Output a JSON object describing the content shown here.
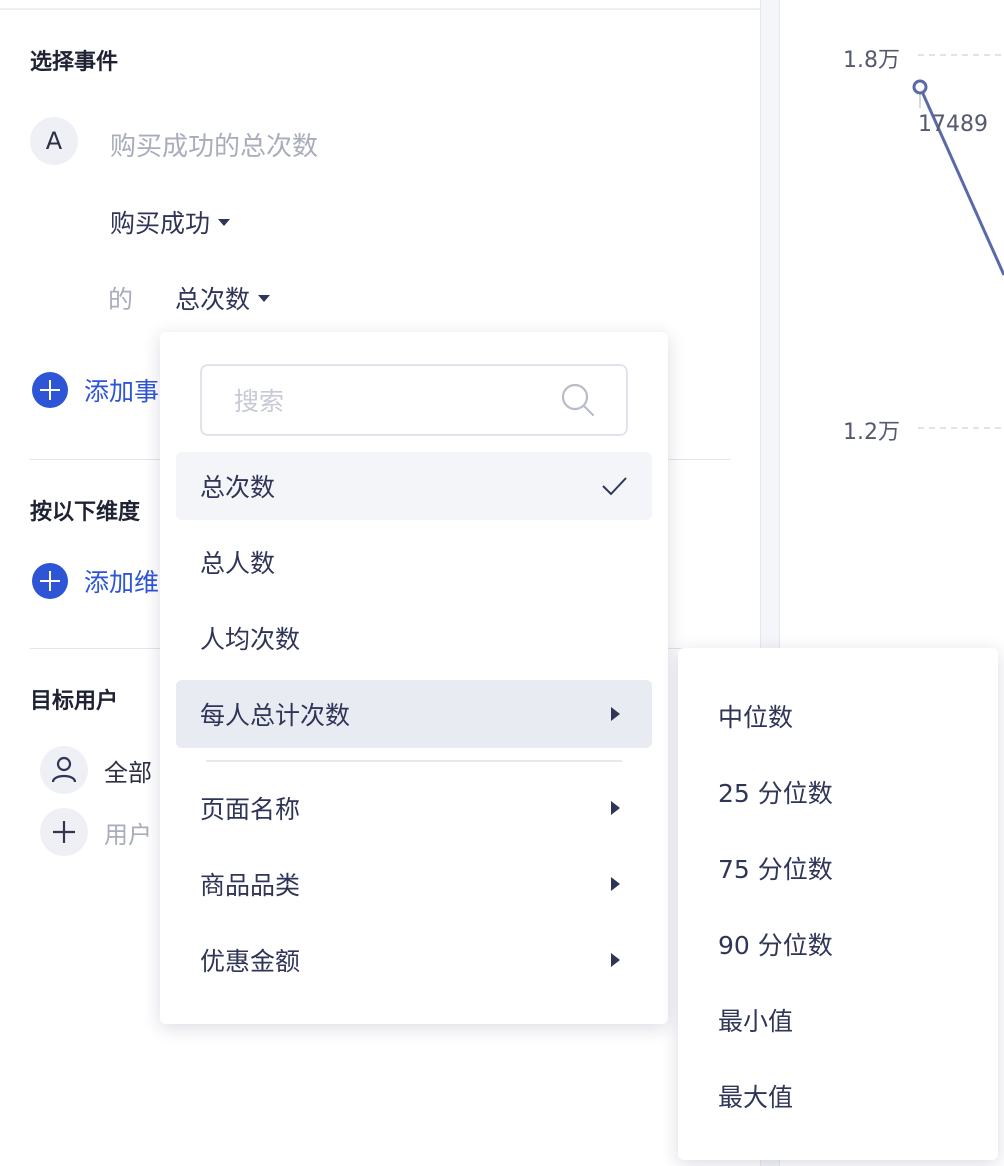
{
  "event_section": {
    "title": "选择事件",
    "badge": "A",
    "metric_name": "购买成功的总次数",
    "event_select": "购买成功",
    "de_label": "的",
    "measure_select": "总次数",
    "add_event_label": "添加事"
  },
  "dimension_section": {
    "title": "按以下维度",
    "add_dimension_label": "添加维"
  },
  "target_section": {
    "title": "目标用户",
    "all_users": "全部",
    "add_user_label": "用户"
  },
  "chart": {
    "ticks": [
      "1.8万",
      "1.2万"
    ],
    "point_label": "17489"
  },
  "dropdown": {
    "search_placeholder": "搜索",
    "items": [
      {
        "label": "总次数",
        "selected": true
      },
      {
        "label": "总人数"
      },
      {
        "label": "人均次数"
      },
      {
        "label": "每人总计次数",
        "submenu": true
      },
      {
        "label": "页面名称",
        "submenu": true
      },
      {
        "label": "商品品类",
        "submenu": true
      },
      {
        "label": "优惠金额",
        "submenu": true
      }
    ]
  },
  "submenu": {
    "items": [
      "中位数",
      "25 分位数",
      "75 分位数",
      "90 分位数",
      "最小值",
      "最大值"
    ]
  },
  "colors": {
    "accent": "#2d55d6",
    "line": "#5a6aa8"
  }
}
